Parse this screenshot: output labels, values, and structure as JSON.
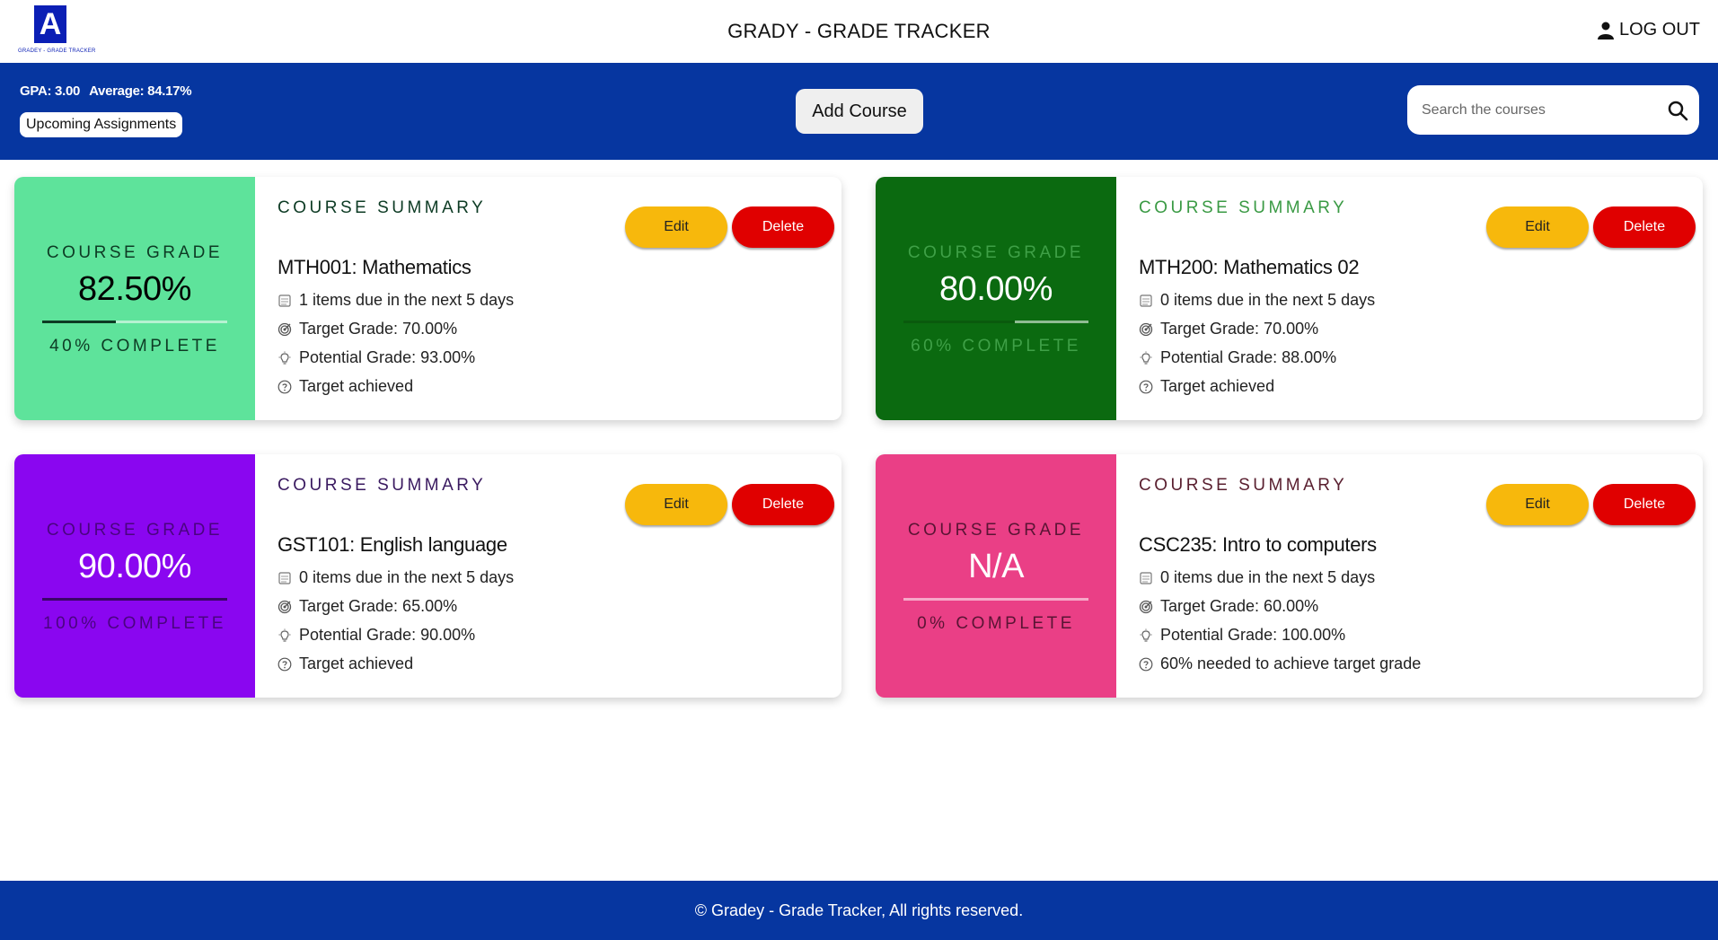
{
  "header": {
    "logo_letter": "A",
    "logo_caption": "GRADEY - GRADE TRACKER",
    "title": "GRADY - GRADE TRACKER",
    "logout_label": "LOG OUT"
  },
  "toolbar": {
    "gpa": "GPA: 3.00",
    "average": "Average: 84.17%",
    "upcoming_label": "Upcoming Assignments",
    "add_course_label": "Add Course",
    "search_placeholder": "Search the courses"
  },
  "labels": {
    "course_grade": "COURSE GRADE",
    "course_summary": "COURSE SUMMARY",
    "edit": "Edit",
    "delete": "Delete"
  },
  "courses": [
    {
      "grade": "82.50%",
      "complete": "40% COMPLETE",
      "complete_fraction": 0.4,
      "name": "MTH001: Mathematics",
      "due": "1 items due in the next 5 days",
      "target": "Target Grade: 70.00%",
      "potential": "Potential Grade: 93.00%",
      "status": "Target achieved",
      "colors": {
        "panel": "#5ee39b",
        "text": "#0d3b24",
        "grade": "#000000",
        "title": "#0d3b24",
        "bar_fill": "#0d3b24"
      }
    },
    {
      "grade": "80.00%",
      "complete": "60% COMPLETE",
      "complete_fraction": 0.6,
      "name": "MTH200: Mathematics 02",
      "due": "0 items due in the next 5 days",
      "target": "Target Grade: 70.00%",
      "potential": "Potential Grade: 88.00%",
      "status": "Target achieved",
      "colors": {
        "panel": "#0b6a10",
        "text": "#3fa047",
        "grade": "#ffffff",
        "title": "#3a9a44",
        "bar_fill": "#0a5a0d"
      }
    },
    {
      "grade": "90.00%",
      "complete": "100% COMPLETE",
      "complete_fraction": 1.0,
      "name": "GST101: English language",
      "due": "0 items due in the next 5 days",
      "target": "Target Grade: 65.00%",
      "potential": "Potential Grade: 90.00%",
      "status": "Target achieved",
      "colors": {
        "panel": "#8a06f0",
        "text": "#4a0480",
        "grade": "#ffffff",
        "title": "#3a1a60",
        "bar_fill": "#3a0568"
      }
    },
    {
      "grade": "N/A",
      "complete": "0% COMPLETE",
      "complete_fraction": 0.0,
      "name": "CSC235: Intro to computers",
      "due": "0 items due in the next 5 days",
      "target": "Target Grade: 60.00%",
      "potential": "Potential Grade: 100.00%",
      "status": "60% needed to achieve target grade",
      "colors": {
        "panel": "#ea3f86",
        "text": "#5a1434",
        "grade": "#ffffff",
        "title": "#5a2030",
        "bar_fill": "#5a1434"
      }
    }
  ],
  "footer": {
    "text": "© Gradey - Grade Tracker, All rights reserved."
  }
}
